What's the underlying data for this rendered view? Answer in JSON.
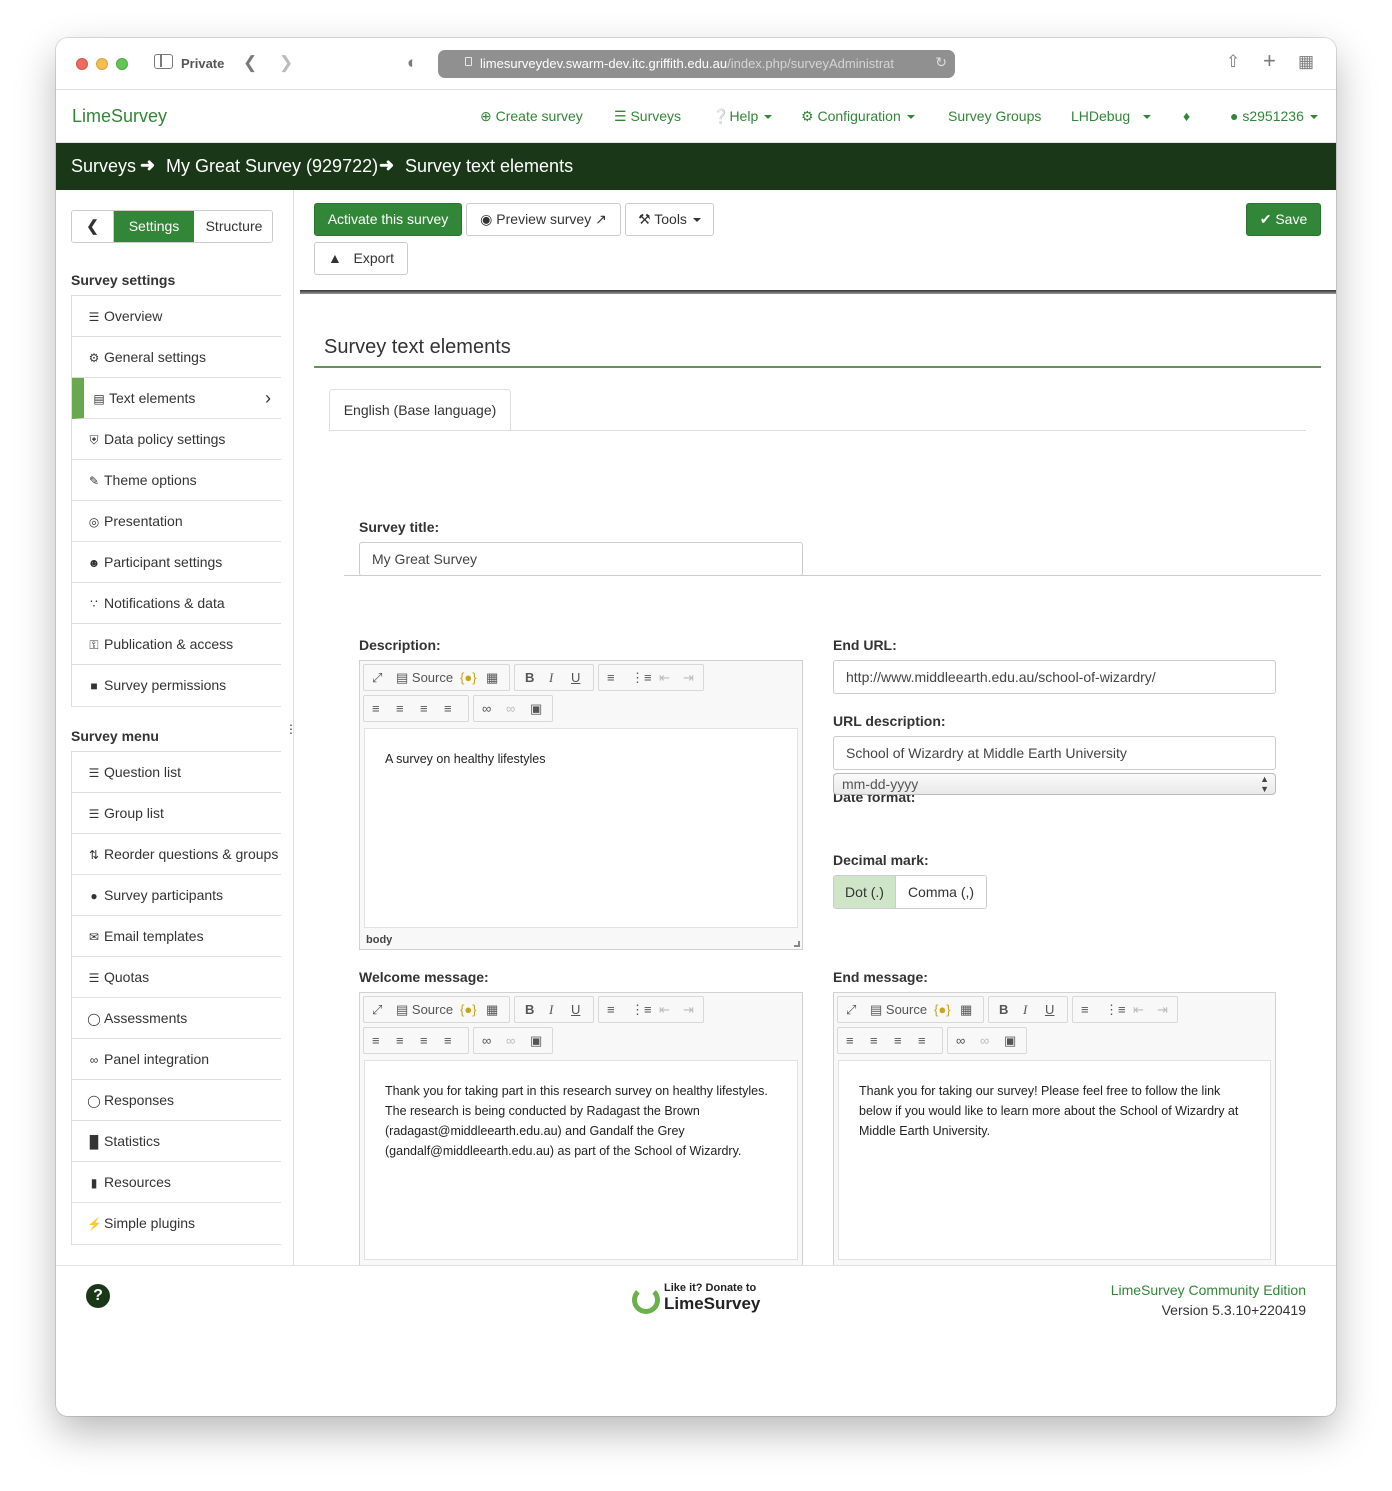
{
  "browser": {
    "private_label": "Private",
    "url_host": "limesurveydev.swarm-dev.itc.griffith.edu.au",
    "url_path": "/index.php/surveyAdministrat"
  },
  "nav": {
    "brand": "LimeSurvey",
    "create_survey": "Create survey",
    "surveys": "Surveys",
    "help": "Help",
    "configuration": "Configuration",
    "survey_groups": "Survey Groups",
    "debug": "LHDebug",
    "user": "s2951236"
  },
  "breadcrumb": {
    "surveys": "Surveys",
    "survey_name": "My Great Survey (929722)",
    "page": "Survey text elements"
  },
  "side": {
    "settings_tab": "Settings",
    "structure_tab": "Structure",
    "settings_heading": "Survey settings",
    "settings_items": [
      {
        "label": "Overview",
        "icon": "list-icon"
      },
      {
        "label": "General settings",
        "icon": "cogs-icon"
      },
      {
        "label": "Text elements",
        "icon": "file-text-icon"
      },
      {
        "label": "Data policy settings",
        "icon": "shield-icon"
      },
      {
        "label": "Theme options",
        "icon": "paint-brush-icon"
      },
      {
        "label": "Presentation",
        "icon": "eye-slash-icon"
      },
      {
        "label": "Participant settings",
        "icon": "users-icon"
      },
      {
        "label": "Notifications & data",
        "icon": "feed-icon"
      },
      {
        "label": "Publication & access",
        "icon": "key-icon"
      },
      {
        "label": "Survey permissions",
        "icon": "lock-icon"
      }
    ],
    "menu_heading": "Survey menu",
    "menu_items": [
      {
        "label": "Question list",
        "icon": "list-icon"
      },
      {
        "label": "Group list",
        "icon": "list-icon"
      },
      {
        "label": "Reorder questions & groups",
        "icon": "sort-icon"
      },
      {
        "label": "Survey participants",
        "icon": "user-icon"
      },
      {
        "label": "Email templates",
        "icon": "envelope-icon"
      },
      {
        "label": "Quotas",
        "icon": "tasks-icon"
      },
      {
        "label": "Assessments",
        "icon": "comment-icon"
      },
      {
        "label": "Panel integration",
        "icon": "link-icon"
      },
      {
        "label": "Responses",
        "icon": "comment-o-icon"
      },
      {
        "label": "Statistics",
        "icon": "bar-chart-icon"
      },
      {
        "label": "Resources",
        "icon": "file-icon"
      },
      {
        "label": "Simple plugins",
        "icon": "plug-icon"
      }
    ]
  },
  "toolbar": {
    "activate": "Activate this survey",
    "preview": "Preview survey",
    "tools": "Tools",
    "export": "Export",
    "save": "Save"
  },
  "content": {
    "section_title": "Survey text elements",
    "language_tab": "English (Base language)",
    "survey_title_label": "Survey title:",
    "survey_title_value": "My Great Survey",
    "description_label": "Description:",
    "description_text": "A survey on healthy lifestyles",
    "end_url_label": "End URL:",
    "end_url_value": "http://www.middleearth.edu.au/school-of-wizardry/",
    "url_desc_label": "URL description:",
    "url_desc_value": "School of Wizardry at Middle Earth University",
    "date_format_label": "Date format:",
    "date_format_value": "mm-dd-yyyy",
    "decimal_label": "Decimal mark:",
    "decimal_dot": "Dot (.)",
    "decimal_comma": "Comma (,)",
    "welcome_label": "Welcome message:",
    "welcome_text": "Thank you for taking part in this research survey on healthy lifestyles. The research is being conducted by Radagast the Brown (radagast@middleearth.edu.au) and Gandalf the Grey (gandalf@middleearth.edu.au) as part of the School of Wizardry.",
    "end_label": "End message:",
    "end_text": "Thank you for taking our survey! Please feel free to follow the link below if you would like to learn more about the School of Wizardry at Middle Earth University."
  },
  "editor": {
    "source": "Source",
    "status": "body"
  },
  "footer": {
    "donate_small": "Like it? Donate to",
    "donate_big": "LimeSurvey",
    "edition": "LimeSurvey Community Edition",
    "version": "Version 5.3.10+220419"
  },
  "colors": {
    "brand_green": "#328637",
    "crumb_bar": "#1a3817",
    "active_marker": "#6aa84f"
  }
}
